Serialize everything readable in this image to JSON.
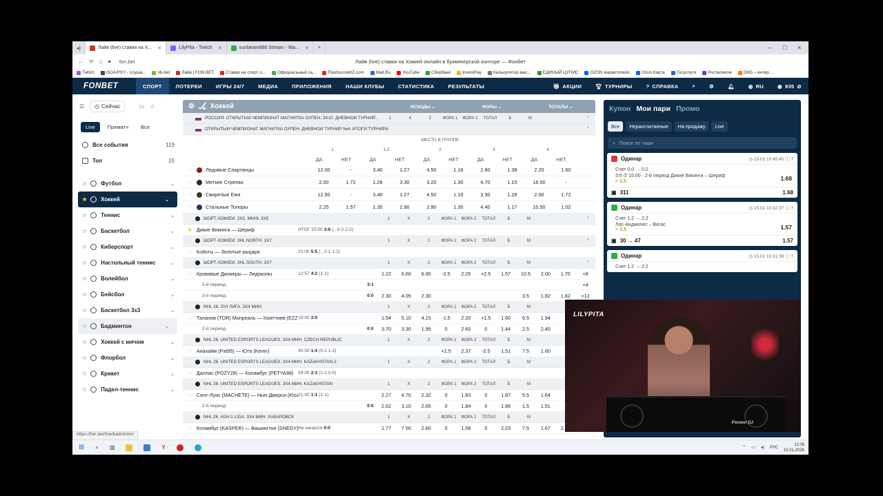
{
  "browser": {
    "tabs": [
      {
        "label": "Лайв (live) ставки на Х...",
        "color": "#d62c2c",
        "active": true
      },
      {
        "label": "LilyPita - Twitch",
        "color": "#8f57ff",
        "active": false
      },
      {
        "label": "sunbeam888 Stream - Wa...",
        "color": "#39a845",
        "active": false
      }
    ],
    "url": "fon.bet",
    "page_title": "Лайв (live) ставки на Хоккей онлайн в букмекерской конторе — Фонбет",
    "bookmarks": [
      {
        "label": "Twitch",
        "color": "#8f57ff"
      },
      {
        "label": "GOA/PSY - слуша...",
        "color": "#444"
      },
      {
        "label": "nb-bet",
        "color": "#6cbf3c"
      },
      {
        "label": "Лайв | FON.BET",
        "color": "#d62c2c"
      },
      {
        "label": "Ставки на спорт о...",
        "color": "#d62c2c"
      },
      {
        "label": "Официальный са...",
        "color": "#3ab54a"
      },
      {
        "label": "FlashscoreKZ.com",
        "color": "#e5202d"
      },
      {
        "label": "Mail.Ru",
        "color": "#1f6fe0"
      },
      {
        "label": "YouTube",
        "color": "#ff0000"
      },
      {
        "label": "Сбербанк",
        "color": "#21a038"
      },
      {
        "label": "InvestPay",
        "color": "#e3b81b"
      },
      {
        "label": "Калькулятор мас...",
        "color": "#777"
      },
      {
        "label": "ЕДИНЫЙ ЦУПИС",
        "color": "#2b8f3c"
      },
      {
        "label": "OZON маркетплейс",
        "color": "#1060ff"
      },
      {
        "label": "Ozon Карта",
        "color": "#1060ff"
      },
      {
        "label": "Госуслуги",
        "color": "#2766d8"
      },
      {
        "label": "Ростелеком",
        "color": "#7b2fd1"
      },
      {
        "label": "DNS – интер...",
        "color": "#ff7a00"
      }
    ]
  },
  "nav": {
    "logo": "FONBET",
    "items": [
      "СПОРТ",
      "ЛОТЕРЕИ",
      "ИГРЫ 24/7",
      "МЕДИА",
      "ПРИЛОЖЕНИЯ",
      "НАШИ КЛУБЫ",
      "СТАТИСТИКА",
      "РЕЗУЛЬТАТЫ"
    ],
    "right": {
      "promo": "АКЦИИ",
      "tournaments": "ТУРНИРЫ",
      "help": "СПРАВКА",
      "lang": "RU",
      "balance": "935"
    }
  },
  "sidebar": {
    "now_label": "Сейчас",
    "segments": [
      "Live",
      "Прематч",
      "Все"
    ],
    "all_events": {
      "label": "Все события",
      "count": "119"
    },
    "top": {
      "label": "Топ",
      "count": "15"
    },
    "sports": [
      "Футбол",
      "Хоккей",
      "Теннис",
      "Баскетбол",
      "Киберспорт",
      "Настольный теннис",
      "Волейбол",
      "Бейсбол",
      "Баскетбол 3х3",
      "Бадминтон",
      "Хоккей с мячом",
      "Флорбол",
      "Крикет",
      "Падел-теннис"
    ]
  },
  "main": {
    "sport": "Хоккей",
    "cols": [
      "ИСХОДЫ",
      "ФОРЫ",
      "ТОТАЛЫ"
    ],
    "league1": "РОССИЯ. ОТКРЫТЫЙ ЧЕМПИОНАТ МАГНИТКА ОУПЕН. 3Х10. ДНЕВНОЙ ТУРНИР...",
    "odds_heads": [
      "1",
      "X",
      "2",
      "ФОРА 1",
      "ФОРА 2",
      "ТОТАЛ",
      "Б",
      "М"
    ],
    "league2": "ОТКРЫТЫЙ ЧЕМПИОНАТ МАГНИТКА ОУПЕН. ДНЕВНОЙ ТУРНИР №4. ИТОГИ ТУРНИРА",
    "place_label": "МЕСТО В ГРУППЕ",
    "place_nums": [
      "1",
      "1-2",
      "2",
      "3",
      "4"
    ],
    "yes_no": [
      "ДА",
      "НЕТ"
    ],
    "group_rows": [
      {
        "team": "Ледовые Спартанцы",
        "vals": [
          "12.00",
          "-",
          "3.40",
          "1.27",
          "4.50",
          "1.16",
          "2.80",
          "1.38",
          "2.20",
          "1.60"
        ]
      },
      {
        "team": "Меткие Стрелки",
        "vals": [
          "2.00",
          "1.72",
          "1.28",
          "3.30",
          "3.20",
          "1.30",
          "4.70",
          "1.15",
          "16.00",
          "-"
        ]
      },
      {
        "team": "Свирепые Ежи",
        "vals": [
          "12.50",
          "-",
          "3.40",
          "1.27",
          "4.50",
          "1.16",
          "3.30",
          "1.28",
          "2.00",
          "1.72"
        ]
      },
      {
        "team": "Стальные Топоры",
        "vals": [
          "2.25",
          "1.57",
          "1.35",
          "2.90",
          "2.90",
          "1.35",
          "4.40",
          "1.17",
          "10.50",
          "1.02"
        ]
      }
    ],
    "events": [
      {
        "league": "ШОРТ-ХОККЕЙ. 2Х2. MNHL 3Х5",
        "rows": [
          {
            "name": "Дикие Викинги — Шериф",
            "info": "ИТОГ 15:00",
            "score": "3:6",
            "per": "(...0-2 2-2)",
            "o": [
              "",
              "",
              "",
              "",
              "",
              "",
              "",
              "",
              "",
              "",
              ""
            ],
            "fav": true
          }
        ]
      },
      {
        "league": "ШОРТ-ХОККЕЙ. 3HL NORTH. 3Х7",
        "rows": [
          {
            "name": "Койоты — Золотые рыцари",
            "info": "21:00",
            "score": "5:5",
            "per": "(...3-1 1-2)",
            "o": [
              "",
              "",
              "",
              "",
              "",
              "",
              "",
              "",
              "",
              "",
              ""
            ]
          }
        ]
      },
      {
        "league": "ШОРТ-ХОККЕЙ. 3HL SOUTH. 3Х7",
        "rows": [
          {
            "name": "Кровавые Джокеры — Ледоколы",
            "info": "12:57",
            "score": "4:2",
            "per": "(1-1)",
            "o": [
              "1.22",
              "6.60",
              "6.90",
              "-2.5",
              "2.25",
              "+2.5",
              "1.57",
              "10.5",
              "2.00",
              "1.70",
              "+8"
            ]
          },
          {
            "name": "2-й период",
            "sub": true,
            "score": "3:1",
            "o": [
              "",
              "",
              "",
              "",
              "",
              "",
              "",
              "",
              "",
              "",
              "+4"
            ]
          },
          {
            "name": "3-й период",
            "sub": true,
            "score": "0:0",
            "o": [
              "2.30",
              "4.05",
              "2.30",
              "",
              "",
              "",
              "",
              "3.5",
              "1.82",
              "1.82",
              "+12"
            ]
          }
        ]
      },
      {
        "league": "NHL 26. OVI ЛИГА. 3Х4 МИН.",
        "rows": [
          {
            "name": "Таланов (TOR) Монреаль — Кюеттиев (EZZ) Детройт",
            "info": "19:00",
            "score": "2:0",
            "per": "",
            "o": [
              "1.54",
              "5.10",
              "4.15",
              "-1.5",
              "2.20",
              "+1.5",
              "1.60",
              "6.5",
              "1.94",
              "",
              ""
            ]
          },
          {
            "name": "2-й период",
            "sub": true,
            "score": "0:0",
            "o": [
              "3.70",
              "3.30",
              "1.99",
              "0",
              "2.60",
              "0",
              "1.44",
              "2.5",
              "2.40",
              "",
              ""
            ]
          }
        ]
      },
      {
        "league": "NHL 26. UNITED ESPORTS LEAGUES. 3Х4 МИН. CZECH REPUBLIC",
        "rows": [
          {
            "name": "Анахайм (Pat95) — Юта (Kevin)",
            "info": "40:00",
            "score": "1:4",
            "per": "(0-2 1-2)",
            "o": [
              "",
              "",
              "",
              "+2.5",
              "2.37",
              "-2.5",
              "1.51",
              "7.5",
              "1.60",
              "",
              ""
            ]
          }
        ]
      },
      {
        "league": "NHL 26. UNITED ESPORTS LEAGUES. 3Х4 МИН. KAZAKHSTAN-2",
        "rows": [
          {
            "name": "Даллас (POZY28) — Коламбус (PETYA98)",
            "info": "59:00",
            "score": "2:3",
            "per": "(1-2 0-0)",
            "o": [
              "",
              "",
              "",
              "",
              "",
              "",
              "",
              "",
              "",
              "",
              ""
            ]
          }
        ]
      },
      {
        "league": "NHL 26. UNITED ESPORTS LEAGUES. 3Х4 МИН. KAZAKHSTAN",
        "rows": [
          {
            "name": "Сент-Луис (MACHETE) — Нью-Джерси (Kloze)",
            "info": "21:00",
            "score": "1:1",
            "per": "(1-1)",
            "o": [
              "2.27",
              "4.70",
              "2.32",
              "0",
              "1.83",
              "0",
              "1.87",
              "5.5",
              "1.64",
              "",
              ""
            ]
          },
          {
            "name": "2-й период",
            "sub": true,
            "score": "0:0",
            "o": [
              "2.62",
              "3.10",
              "2.65",
              "0",
              "1.84",
              "0",
              "1.86",
              "1.5",
              "1.51",
              "",
              ""
            ]
          }
        ]
      },
      {
        "league": "NHL 26. H2H-1 LIGA. 3Х4 МИН. ХАБАРОВСК",
        "rows": [
          {
            "name": "Коламбус (KASPER) — Вашингтон (SNEGY)",
            "info": "Не начался",
            "score": "0:0",
            "per": "",
            "o": [
              "1.77",
              "7.50",
              "2.60",
              "0",
              "1.58",
              "0",
              "2.23",
              "7.5",
              "1.67",
              "2.07",
              "+65"
            ]
          }
        ]
      }
    ]
  },
  "coupon": {
    "tabs": [
      "Купон",
      "Мои пари",
      "Промо"
    ],
    "filters": [
      "Все",
      "Нерассчитанные",
      "На продажу",
      "Live"
    ],
    "search_placeholder": "Поиск по пари",
    "bets": [
      {
        "type": "Одинар",
        "status_color": "#d93a3a",
        "date": "15.01",
        "time": "10:45:45",
        "score": "Счет 0:0 → 0:2",
        "line": "3:6 ⏱ 15:00 · 2-й период Дикие Викинги – Шериф",
        "pick": "> 3.5",
        "odd": "1.68",
        "id": "311",
        "foot_odd": "1.68"
      },
      {
        "type": "Одинар",
        "status_color": "#2bb04a",
        "date": "15.01",
        "time": "10:32:37",
        "score": "Счет 1:2 → 2:2",
        "line": "Лос-Анджелес – Вегас",
        "pick": "> 3.5",
        "odd": "1.57",
        "id": "30 → 47",
        "foot_odd": "1.57"
      },
      {
        "type": "Одинар",
        "status_color": "#2bb04a",
        "date": "15.01",
        "time": "10:31:38",
        "score": "Счет 1:2 → 2:2",
        "line": "",
        "pick": "",
        "odd": "",
        "id": "",
        "foot_odd": ""
      }
    ]
  },
  "overlay": {
    "brand": "LILYPITA",
    "deck_label": "Pioneer DJ"
  },
  "statusbar": {
    "url": "https://fon.bet/live/badminton"
  },
  "taskbar": {
    "lang": "РУС",
    "time": "11:06",
    "date": "15.01.2026"
  }
}
